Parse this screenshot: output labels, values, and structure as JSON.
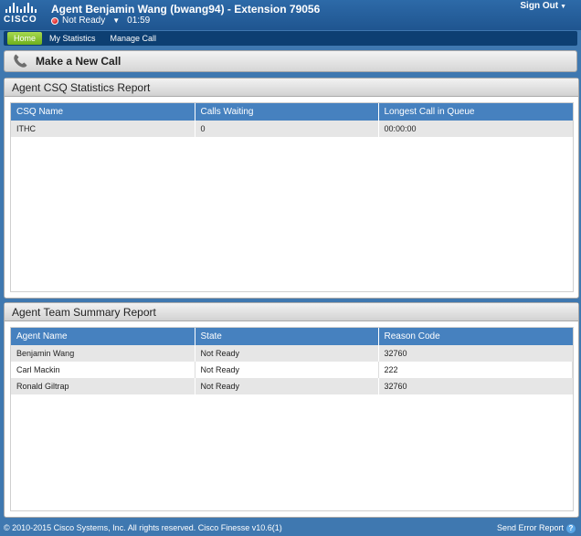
{
  "header": {
    "logo_text": "CISCO",
    "agent_title": "Agent Benjamin Wang (bwang94) - Extension 79056",
    "state": "Not Ready",
    "timer": "01:59",
    "sign_out": "Sign Out"
  },
  "nav": {
    "items": [
      {
        "label": "Home",
        "active": true
      },
      {
        "label": "My Statistics",
        "active": false
      },
      {
        "label": "Manage Call",
        "active": false
      }
    ]
  },
  "call_bar": {
    "label": "Make a New Call",
    "icon": "phone-icon"
  },
  "csq_report": {
    "title": "Agent CSQ Statistics Report",
    "columns": [
      "CSQ Name",
      "Calls Waiting",
      "Longest Call in Queue"
    ],
    "rows": [
      [
        "ITHC",
        "0",
        "00:00:00"
      ]
    ]
  },
  "team_report": {
    "title": "Agent Team Summary Report",
    "columns": [
      "Agent Name",
      "State",
      "Reason Code"
    ],
    "rows": [
      [
        "Benjamin Wang",
        "Not Ready",
        "32760"
      ],
      [
        "Carl Mackin",
        "Not Ready",
        "222"
      ],
      [
        "Ronald Giltrap",
        "Not Ready",
        "32760"
      ]
    ]
  },
  "footer": {
    "copyright": "© 2010-2015 Cisco Systems, Inc. All rights reserved. Cisco Finesse v10.6(1)",
    "send_error": "Send Error Report"
  },
  "colors": {
    "background": "#3f78b0",
    "table_header": "#4681bf",
    "active_tab": "#8cc63f",
    "not_ready": "#c30000"
  }
}
